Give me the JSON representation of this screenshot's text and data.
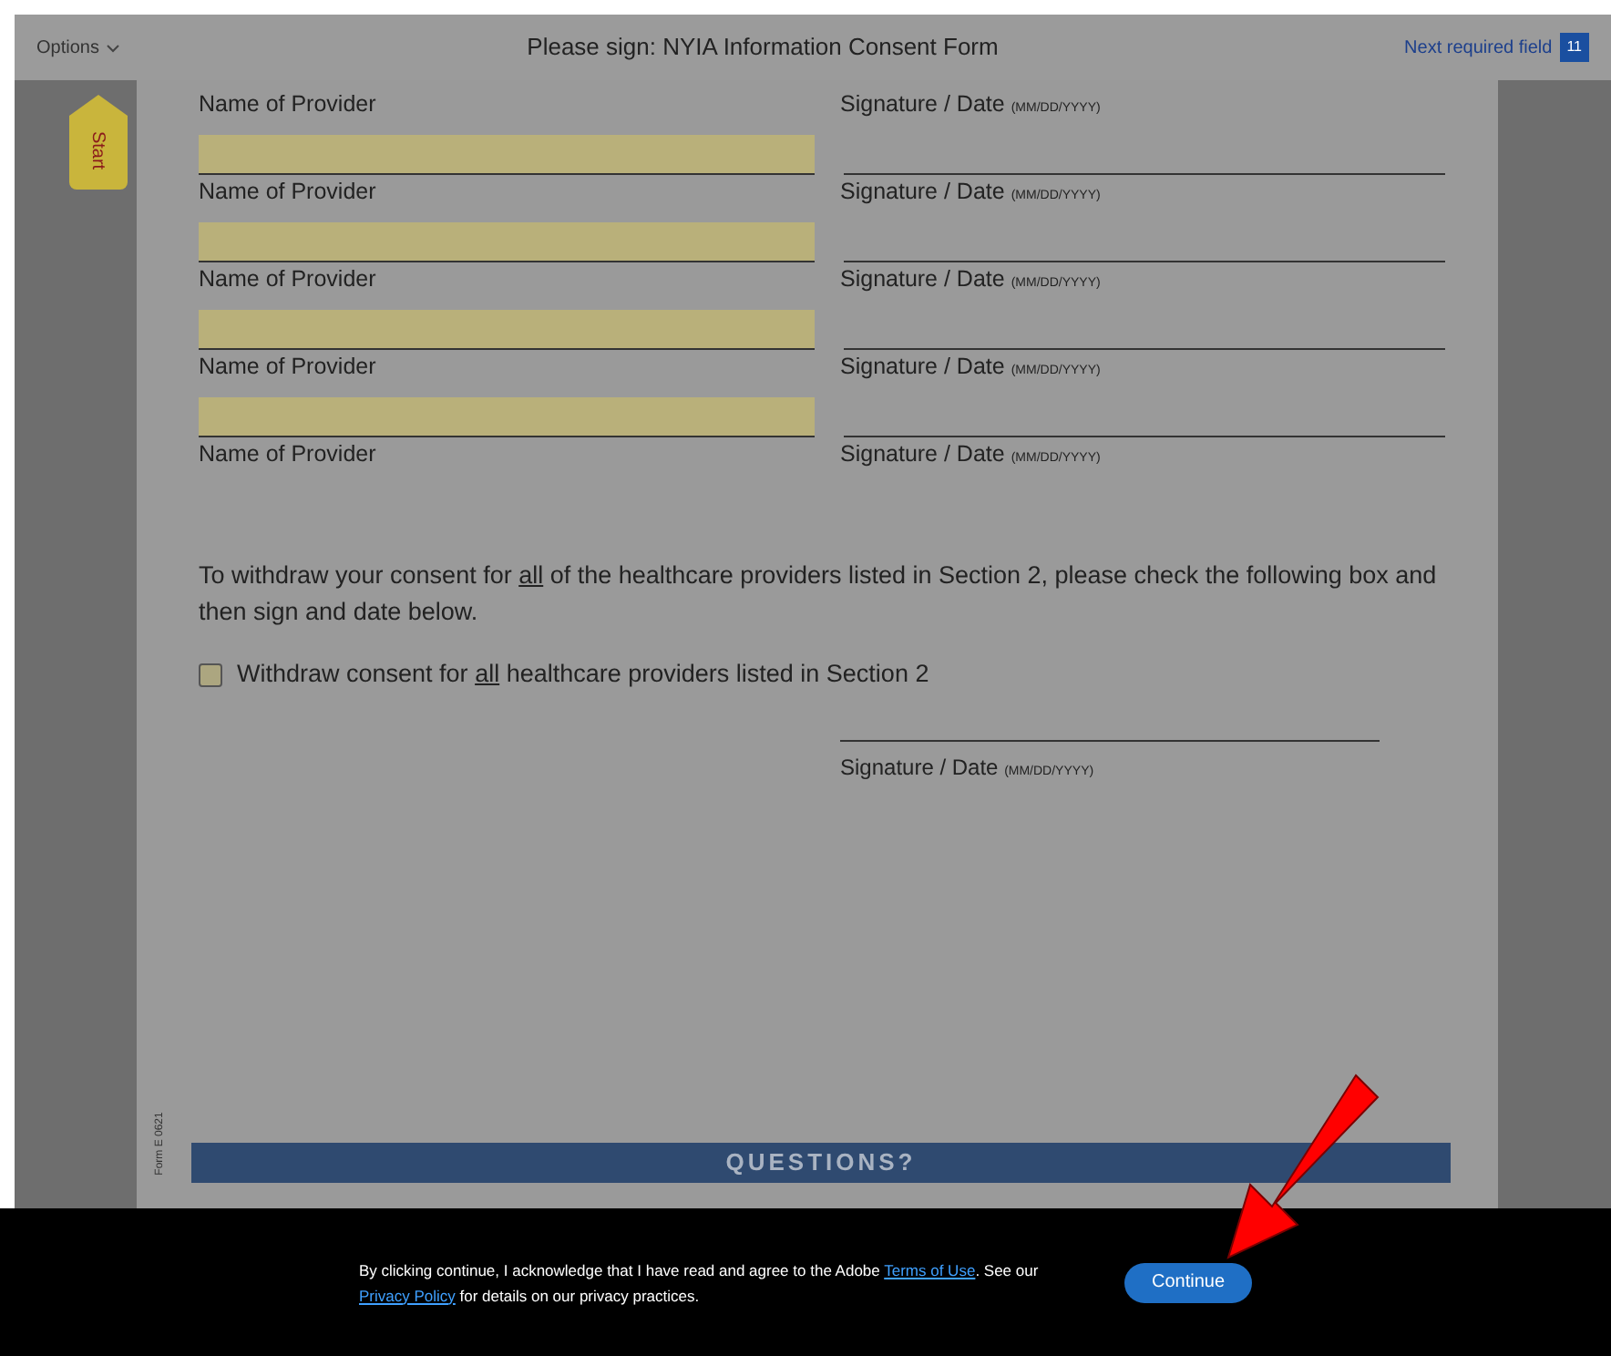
{
  "toolbar": {
    "options": "Options",
    "title": "Please sign: NYIA Information Consent Form",
    "next_field": "Next required field",
    "required_count": "11"
  },
  "start_tab": "Start",
  "form": {
    "rows": [
      {
        "kind": "labels",
        "name": "Name of Provider",
        "signature": "Signature / Date",
        "format": "(MM/DD/YYYY)"
      },
      {
        "kind": "field"
      },
      {
        "kind": "labels",
        "name": "Name of Provider",
        "signature": "Signature / Date",
        "format": "(MM/DD/YYYY)"
      },
      {
        "kind": "field"
      },
      {
        "kind": "labels",
        "name": "Name of Provider",
        "signature": "Signature / Date",
        "format": "(MM/DD/YYYY)"
      },
      {
        "kind": "field"
      },
      {
        "kind": "labels",
        "name": "Name of Provider",
        "signature": "Signature / Date",
        "format": "(MM/DD/YYYY)"
      },
      {
        "kind": "field"
      },
      {
        "kind": "labels",
        "name": "Name of Provider",
        "signature": "Signature / Date",
        "format": "(MM/DD/YYYY)"
      }
    ],
    "instruction": [
      {
        "text": "To withdraw your consent for "
      },
      {
        "text": "all",
        "underline": true
      },
      {
        "text": " of the healthcare providers listed in Section 2, please check the following box and then sign and date below."
      }
    ],
    "withdraw": {
      "checked": false,
      "label": [
        {
          "text": "Withdraw consent for "
        },
        {
          "text": "all",
          "underline": true
        },
        {
          "text": " healthcare providers listed in Section 2"
        }
      ]
    },
    "final_signature": {
      "signature": "Signature / Date",
      "format": "(MM/DD/YYYY)"
    },
    "form_id": "Form E 0621",
    "section_heading": "QUESTIONS?"
  },
  "consent_bar": {
    "text_before": "By clicking continue, I acknowledge that I have read and agree to the Adobe ",
    "terms_link": "Terms of Use",
    "text_mid": ". See our ",
    "privacy_link": "Privacy Policy",
    "text_after": " for details on our privacy practices.",
    "button": "Continue"
  }
}
